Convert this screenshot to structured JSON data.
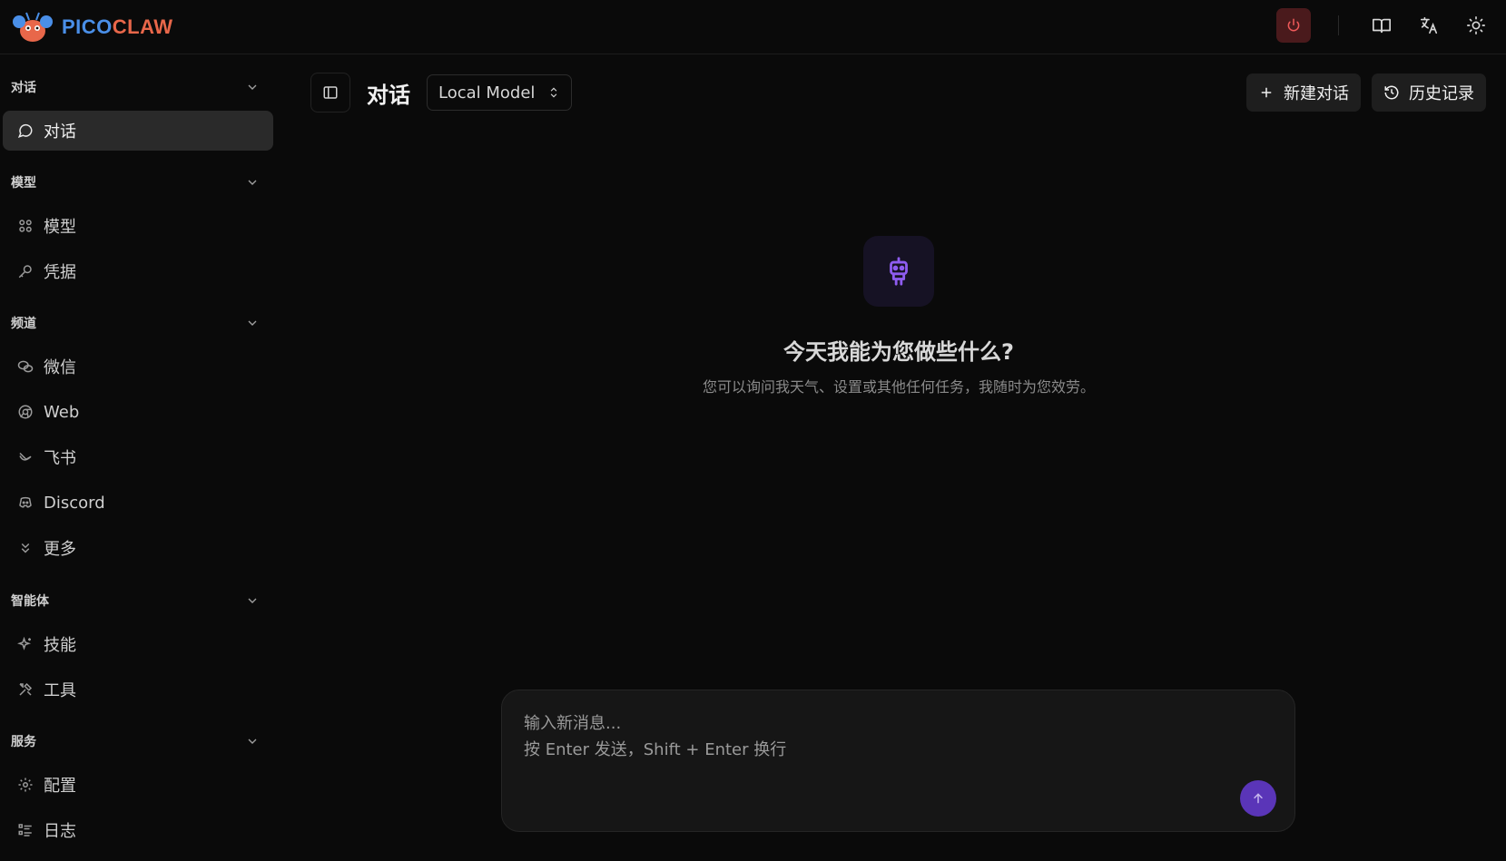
{
  "brand": {
    "name_part1": "PICO",
    "name_part2": "CLAW"
  },
  "topbar": {
    "icons": [
      "power-icon",
      "book-icon",
      "translate-icon",
      "sun-icon"
    ]
  },
  "sidebar": {
    "sections": [
      {
        "title": "对话",
        "items": [
          {
            "label": "对话",
            "icon": "message-circle-icon",
            "active": true
          }
        ]
      },
      {
        "title": "模型",
        "items": [
          {
            "label": "模型",
            "icon": "model-icon"
          },
          {
            "label": "凭据",
            "icon": "key-icon"
          }
        ]
      },
      {
        "title": "频道",
        "items": [
          {
            "label": "微信",
            "icon": "wechat-icon"
          },
          {
            "label": "Web",
            "icon": "web-icon"
          },
          {
            "label": "飞书",
            "icon": "feishu-icon"
          },
          {
            "label": "Discord",
            "icon": "discord-icon"
          },
          {
            "label": "更多",
            "icon": "chevrons-down-icon"
          }
        ]
      },
      {
        "title": "智能体",
        "items": [
          {
            "label": "技能",
            "icon": "sparkles-icon"
          },
          {
            "label": "工具",
            "icon": "tools-icon"
          }
        ]
      },
      {
        "title": "服务",
        "items": [
          {
            "label": "配置",
            "icon": "gear-icon"
          },
          {
            "label": "日志",
            "icon": "list-icon"
          }
        ]
      }
    ]
  },
  "main": {
    "title": "对话",
    "model_select": "Local Model",
    "new_chat_label": "新建对话",
    "history_label": "历史记录",
    "hero_title": "今天我能为您做些什么?",
    "hero_subtitle": "您可以询问我天气、设置或其他任何任务，我随时为您效劳。",
    "composer_placeholder": "输入新消息...\n按 Enter 发送，Shift + Enter 换行"
  },
  "colors": {
    "background": "#0a0a0a",
    "accent": "#5a35b8",
    "logo_blue": "#4a8fe8",
    "logo_orange": "#e8674a",
    "danger": "#f05a5a"
  }
}
